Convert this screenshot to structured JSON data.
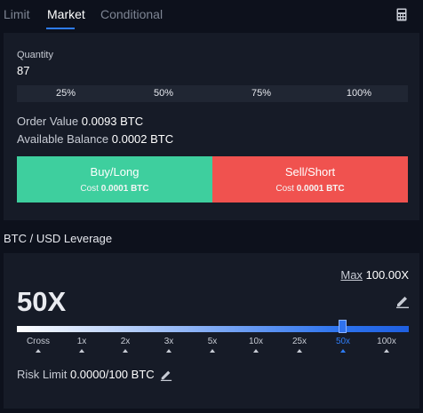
{
  "tabs": [
    {
      "label": "Limit",
      "active": false
    },
    {
      "label": "Market",
      "active": true
    },
    {
      "label": "Conditional",
      "active": false
    }
  ],
  "icons": {
    "calculator": "calculator-icon",
    "edit": "pencil-icon"
  },
  "order": {
    "quantity_label": "Quantity",
    "quantity_value": "87",
    "percent_options": [
      "25%",
      "50%",
      "75%",
      "100%"
    ],
    "order_value_label": "Order Value",
    "order_value": "0.0093 BTC",
    "available_balance_label": "Available Balance",
    "available_balance": "0.0002 BTC"
  },
  "buy": {
    "label": "Buy/Long",
    "cost_label": "Cost",
    "cost_value": "0.0001 BTC",
    "color": "#3ecf9e"
  },
  "sell": {
    "label": "Sell/Short",
    "cost_label": "Cost",
    "cost_value": "0.0001 BTC",
    "color": "#f0524f"
  },
  "leverage": {
    "title": "BTC / USD Leverage",
    "max_label": "Max",
    "max_value": "100.00X",
    "current": "50X",
    "ticks": [
      "Cross",
      "1x",
      "2x",
      "3x",
      "5x",
      "10x",
      "25x",
      "50x",
      "100x"
    ],
    "selected_index": 7,
    "risk_limit_label": "Risk Limit",
    "risk_limit_value": "0.0000/100 BTC",
    "accent": "#2e7cf6"
  }
}
